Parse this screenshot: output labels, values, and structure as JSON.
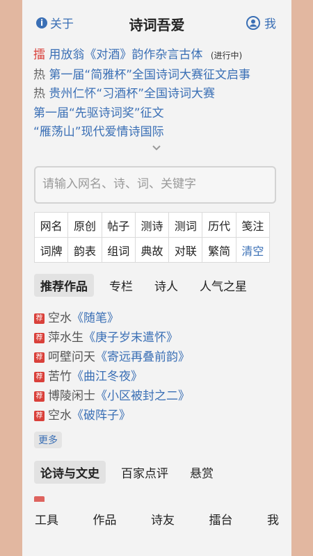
{
  "header": {
    "about_label": "关于",
    "title": "诗词吾爱",
    "me_label": "我"
  },
  "news": [
    {
      "tag": "擂",
      "tag_color": "#d9403a",
      "text": "用放翁《对酒》韵作杂言古体",
      "status": "(进行中)"
    },
    {
      "tag": "热",
      "text": "第一届“简雅杯”全国诗词大赛征文启事"
    },
    {
      "tag": "热",
      "text": "贵州仁怀“习酒杯”全国诗词大赛"
    },
    {
      "tag": "",
      "text": "第一届“先驱诗词奖”征文"
    },
    {
      "tag": "",
      "text": "“雁荡山”现代爱情诗国际"
    }
  ],
  "search": {
    "placeholder": "请输入网名、诗、词、关键字"
  },
  "categories": [
    [
      "网名",
      "原创",
      "帖子",
      "测诗",
      "测词",
      "历代",
      "笺注"
    ],
    [
      "词牌",
      "韵表",
      "组词",
      "典故",
      "对联",
      "繁简",
      "清空"
    ]
  ],
  "tabs_primary": [
    "推荐作品",
    "专栏",
    "诗人",
    "人气之星"
  ],
  "works": [
    {
      "badge": "荐",
      "author": "空水",
      "title": "《随笔》"
    },
    {
      "badge": "荐",
      "author": "萍水生",
      "title": "《庚子岁末遣怀》"
    },
    {
      "badge": "荐",
      "author": "呵壁问天",
      "title": "《寄远再叠前韵》"
    },
    {
      "badge": "荐",
      "author": "苦竹",
      "title": "《曲江冬夜》"
    },
    {
      "badge": "荐",
      "author": "博陵闲士",
      "title": "《小区被封之二》"
    },
    {
      "badge": "荐",
      "author": "空水",
      "title": "《破阵子》"
    }
  ],
  "more_label": "更多",
  "tabs_secondary": [
    "论诗与文史",
    "百家点评",
    "悬赏"
  ],
  "bottom_nav": [
    "工具",
    "作品",
    "诗友",
    "擂台",
    "我"
  ],
  "colors": {
    "accent": "#3a6fb5",
    "badge": "#d9403a",
    "background": "#e2b7a0"
  }
}
